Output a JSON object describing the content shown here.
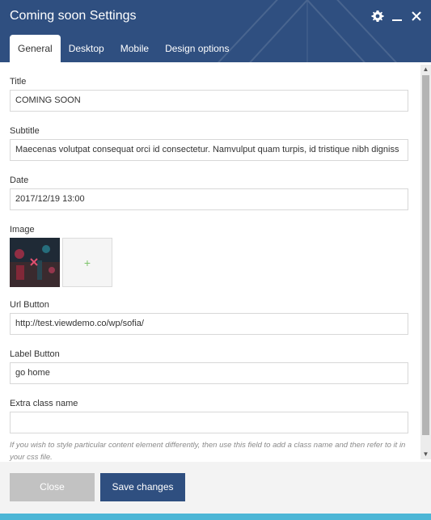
{
  "window": {
    "title": "Coming soon Settings",
    "icons": [
      "gear-icon",
      "minimize-icon",
      "close-icon"
    ]
  },
  "tabs": [
    {
      "label": "General",
      "active": true
    },
    {
      "label": "Desktop",
      "active": false
    },
    {
      "label": "Mobile",
      "active": false
    },
    {
      "label": "Design options",
      "active": false
    }
  ],
  "form": {
    "title": {
      "label": "Title",
      "value": "COMING SOON"
    },
    "subtitle": {
      "label": "Subtitle",
      "value": "Maecenas volutpat consequat orci id consectetur. Namvulput quam turpis, id tristique nibh digniss"
    },
    "date": {
      "label": "Date",
      "value": "2017/12/19 13:00"
    },
    "image": {
      "label": "Image",
      "add_symbol": "+"
    },
    "url_button": {
      "label": "Url Button",
      "value": "http://test.viewdemo.co/wp/sofia/"
    },
    "label_button": {
      "label": "Label Button",
      "value": "go home"
    },
    "extra_class": {
      "label": "Extra class name",
      "value": ""
    },
    "help_text": "If you wish to style particular content element differently, then use this field to add a class name and then refer to it in your css file."
  },
  "footer": {
    "close_label": "Close",
    "save_label": "Save changes"
  },
  "colors": {
    "header": "#2f4f80",
    "primary_button": "#2f4f80",
    "close_button": "#c2c2c2",
    "add_plus": "#7dc46a",
    "bottom_strip": "#4cb6d6"
  }
}
